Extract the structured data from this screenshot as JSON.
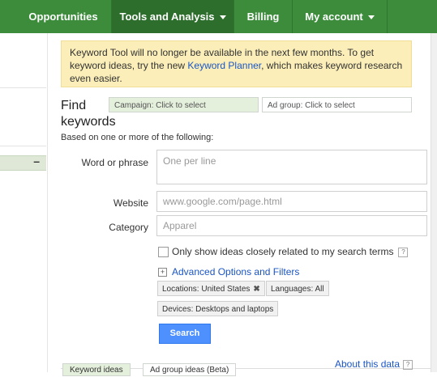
{
  "nav": {
    "items": [
      {
        "label": "Opportunities",
        "dropdown": false
      },
      {
        "label": "Tools and Analysis",
        "dropdown": true
      },
      {
        "label": "Billing",
        "dropdown": false
      },
      {
        "label": "My account",
        "dropdown": true
      }
    ]
  },
  "left": {
    "collapse_symbol": "–"
  },
  "notice": {
    "text_before": "Keyword Tool will no longer be available in the next few months. To get keyword ideas, try the new ",
    "link": "Keyword Planner",
    "text_after": ", which makes keyword research even easier."
  },
  "find": {
    "title": "Find keywords",
    "campaign": "Campaign: Click to select",
    "adgroup": "Ad group: Click to select",
    "based_on": "Based on one or more of the following:"
  },
  "form": {
    "word_label": "Word or phrase",
    "word_placeholder": "One per line",
    "website_label": "Website",
    "website_placeholder": "www.google.com/page.html",
    "category_label": "Category",
    "category_placeholder": "Apparel",
    "checkbox_label": "Only show ideas closely related to my search terms",
    "help_symbol": "?",
    "advanced_label": "Advanced Options and Filters",
    "plus_symbol": "+"
  },
  "filters": {
    "location": "Locations: United States",
    "location_remove": "✖",
    "languages": "Languages: All",
    "devices": "Devices: Desktops and laptops"
  },
  "search_button": "Search",
  "tabs": {
    "keyword_ideas": "Keyword ideas",
    "ad_group_ideas": "Ad group ideas (Beta)"
  },
  "about": {
    "label": "About this data",
    "help_symbol": "?"
  },
  "colors": {
    "nav": "#3c8c3c",
    "notice_bg": "#fbeeb8",
    "link": "#1a55c4",
    "search_button": "#4d90fe"
  }
}
